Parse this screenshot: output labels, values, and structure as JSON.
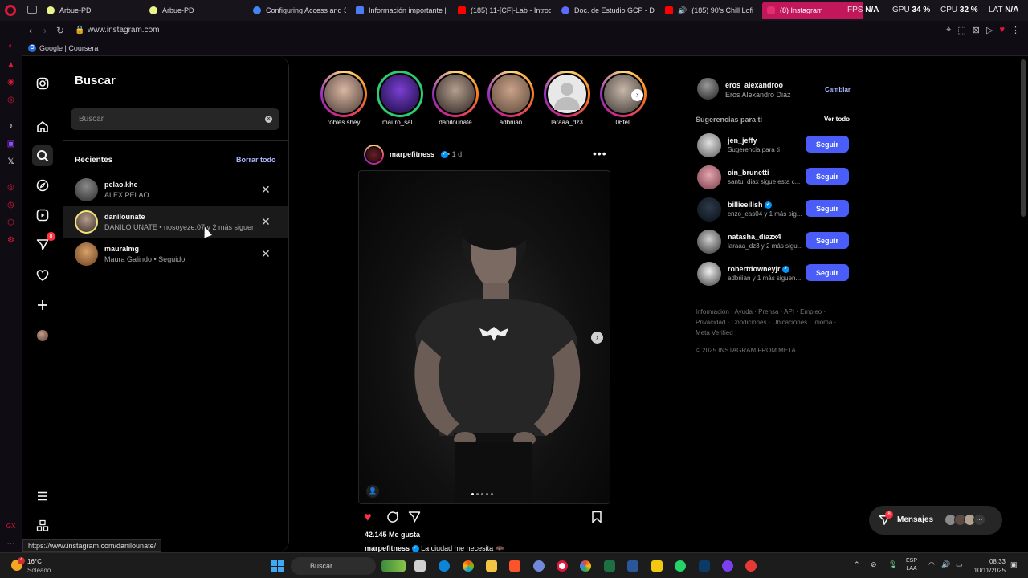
{
  "browser": {
    "tabs": [
      {
        "title": "Arbue-PD",
        "color": "#e8f58a"
      },
      {
        "title": "Arbue-PD",
        "color": "#e8f58a"
      },
      {
        "title": "Configuring Access and S",
        "color": "#4285f4"
      },
      {
        "title": "Información importante |",
        "color": "#4c7ef3"
      },
      {
        "title": "(185) 11-[CF]-Lab - Introd",
        "color": "#ff0000"
      },
      {
        "title": "Doc. de Estudio GCP - De",
        "color": "#5b6cff"
      },
      {
        "title": "(185) 90's Chill Lofi",
        "color": "#ff0000"
      },
      {
        "title": "(8) Instagram",
        "color": "#e1306c"
      }
    ],
    "perf": {
      "fps_label": "FPS",
      "fps_value": "N/A",
      "gpu_label": "GPU",
      "gpu_value": "34 %",
      "cpu_label": "CPU",
      "cpu_value": "32 %",
      "lat_label": "LAT",
      "lat_value": "N/A"
    },
    "url": "www.instagram.com",
    "bookmark": "Google | Coursera",
    "status_url": "https://www.instagram.com/danilounate/"
  },
  "search_panel": {
    "title": "Buscar",
    "placeholder": "Buscar",
    "recent_label": "Recientes",
    "clear_all": "Borrar todo",
    "items": [
      {
        "username": "pelao.khe",
        "subtitle": "ALEX PELAO"
      },
      {
        "username": "danilounate",
        "subtitle": "DANILO UNATE • nosoyeze.07 y 2 más siguen e"
      },
      {
        "username": "mauralmg",
        "subtitle": "Maura Galindo • Seguido"
      }
    ]
  },
  "nav": {
    "notifications_badge": "8"
  },
  "stories": [
    "robles.shey",
    "mauro_sal...",
    "danilounate",
    "adbriian",
    "laraaa_dz3",
    "06feli"
  ],
  "post": {
    "username": "marpefitness_",
    "time": "• 1 d",
    "likes": "42.145 Me gusta",
    "caption_user": "marpefitness",
    "caption_text": "La ciudad me necesita 🦇",
    "image_position": 0,
    "image_count": 5
  },
  "sidebar_right": {
    "me_username": "eros_alexandroo",
    "me_name": "Eros Alexandro Diaz",
    "switch_label": "Cambiar",
    "suggestions_header": "Sugerencias para ti",
    "see_all": "Ver todo",
    "suggestions": [
      {
        "username": "jen_jeffy",
        "subtitle": "Sugerencia para ti",
        "follow": "Seguir"
      },
      {
        "username": "cin_brunetti",
        "subtitle": "santu_diax sigue esta c...",
        "follow": "Seguir"
      },
      {
        "username": "billieeilish",
        "subtitle": "cnzo_eas04 y 1 más sig...",
        "follow": "Seguir"
      },
      {
        "username": "natasha_diazx4",
        "subtitle": "laraaa_dz3 y 2 más sigu...",
        "follow": "Seguir"
      },
      {
        "username": "robertdowneyjr",
        "subtitle": "adbriian y 1 más siguen...",
        "follow": "Seguir"
      }
    ],
    "footer_links": "Información · Ayuda · Prensa · API · Empleo · Privacidad · Condiciones · Ubicaciones · Idioma · Meta Verified",
    "copyright": "© 2025 INSTAGRAM FROM META"
  },
  "messages": {
    "label": "Mensajes",
    "badge": "8"
  },
  "taskbar": {
    "weather_badge": "4",
    "temperature": "16°C",
    "condition": "Soleado",
    "search_placeholder": "Buscar",
    "lang_top": "ESP",
    "lang_bottom": "LAA",
    "time": "08:33",
    "date": "10/11/2025"
  }
}
